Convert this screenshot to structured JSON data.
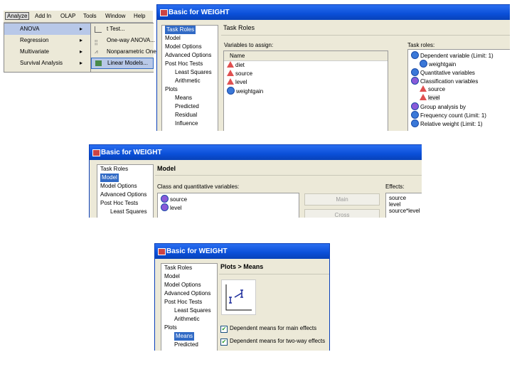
{
  "menubar": {
    "items": [
      "Analyze",
      "Add In",
      "OLAP",
      "Tools",
      "Window",
      "Help"
    ]
  },
  "analyze_menu": {
    "items": [
      {
        "label": "ANOVA",
        "arrow": "▸"
      },
      {
        "label": "Regression",
        "arrow": "▸"
      },
      {
        "label": "Multivariate",
        "arrow": "▸"
      },
      {
        "label": "Survival Analysis",
        "arrow": "▸"
      }
    ]
  },
  "anova_submenu": {
    "items": [
      {
        "label": "t Test...",
        "icon": "t-test-icon"
      },
      {
        "label": "One-way ANOVA...",
        "icon": "anova-icon"
      },
      {
        "label": "Nonparametric One",
        "icon": "nonparametric-icon"
      },
      {
        "label": "Linear Models...",
        "icon": "linear-models-icon"
      }
    ]
  },
  "window_title": "Basic for WEIGHT",
  "nav": [
    "Task Roles",
    "Model",
    "Model Options",
    "Advanced Options",
    "Post Hoc Tests",
    "Least Squares",
    "Arithmetic",
    "Plots",
    "Means",
    "Predicted",
    "Residual",
    "Influence"
  ],
  "task_roles": {
    "heading": "Task Roles",
    "vars_label": "Variables to assign:",
    "name_header": "Name",
    "variables": [
      {
        "name": "diet",
        "type": "class"
      },
      {
        "name": "source",
        "type": "class"
      },
      {
        "name": "level",
        "type": "class"
      },
      {
        "name": "weightgain",
        "type": "numeric"
      }
    ],
    "roles_label": "Task roles:",
    "roles": [
      {
        "label": "Dependent variable (Limit: 1)",
        "indent": 0,
        "type": "role"
      },
      {
        "label": "weightgain",
        "indent": 1,
        "type": "numeric"
      },
      {
        "label": "Quantitative variables",
        "indent": 0,
        "type": "role"
      },
      {
        "label": "Classification variables",
        "indent": 0,
        "type": "role"
      },
      {
        "label": "source",
        "indent": 1,
        "type": "class"
      },
      {
        "label": "level",
        "indent": 1,
        "type": "class"
      },
      {
        "label": "Group analysis by",
        "indent": 0,
        "type": "role"
      },
      {
        "label": "Frequency count (Limit: 1)",
        "indent": 0,
        "type": "role"
      },
      {
        "label": "Relative weight (Limit: 1)",
        "indent": 0,
        "type": "role"
      }
    ]
  },
  "model": {
    "heading": "Model",
    "vars_label": "Class and quantitative variables:",
    "variables": [
      "source",
      "level"
    ],
    "buttons": [
      "Main",
      "Cross"
    ],
    "effects_label": "Effects:",
    "effects": [
      "source",
      "level",
      "source*level"
    ]
  },
  "means": {
    "heading": "Plots > Means",
    "checks": [
      {
        "label": "Dependent means for main effects",
        "checked": true
      },
      {
        "label": "Dependent means for two-way effects",
        "checked": true
      }
    ]
  }
}
